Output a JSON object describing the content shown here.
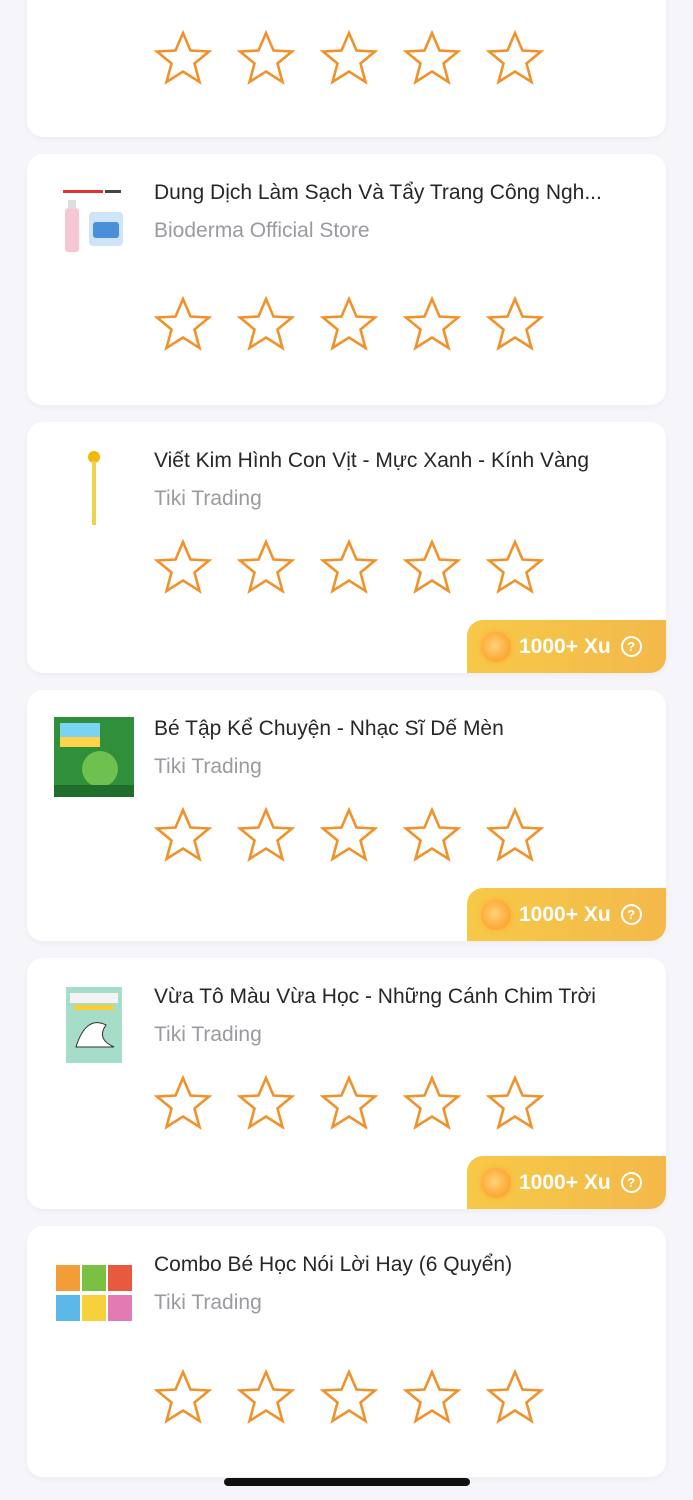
{
  "products": [
    {
      "title": "",
      "store": "",
      "rating": 0,
      "xu": null
    },
    {
      "title": "Dung Dịch Làm Sạch Và Tẩy Trang Công Ngh...",
      "store": "Bioderma Official Store",
      "rating": 0,
      "xu": null
    },
    {
      "title": "Viết Kim Hình Con Vịt - Mực Xanh - Kính Vàng",
      "store": "Tiki Trading",
      "rating": 0,
      "xu": "1000+ Xu"
    },
    {
      "title": "Bé Tập Kể Chuyện - Nhạc Sĩ Dế Mèn",
      "store": "Tiki Trading",
      "rating": 0,
      "xu": "1000+ Xu"
    },
    {
      "title": "Vừa Tô Màu Vừa Học - Những Cánh Chim Trời",
      "store": "Tiki Trading",
      "rating": 0,
      "xu": "1000+ Xu"
    },
    {
      "title": "Combo Bé Học Nói Lời Hay (6 Quyển)",
      "store": "Tiki Trading",
      "rating": 0,
      "xu": null
    }
  ],
  "colors": {
    "star": "#f0922b",
    "xu_bg": "#f5c247",
    "text": "#27272a",
    "muted": "#9a9aa0"
  },
  "icons": {
    "star": "star-outline-icon",
    "coin": "coin-icon",
    "help": "question-circle-icon"
  },
  "help_glyph": "?"
}
